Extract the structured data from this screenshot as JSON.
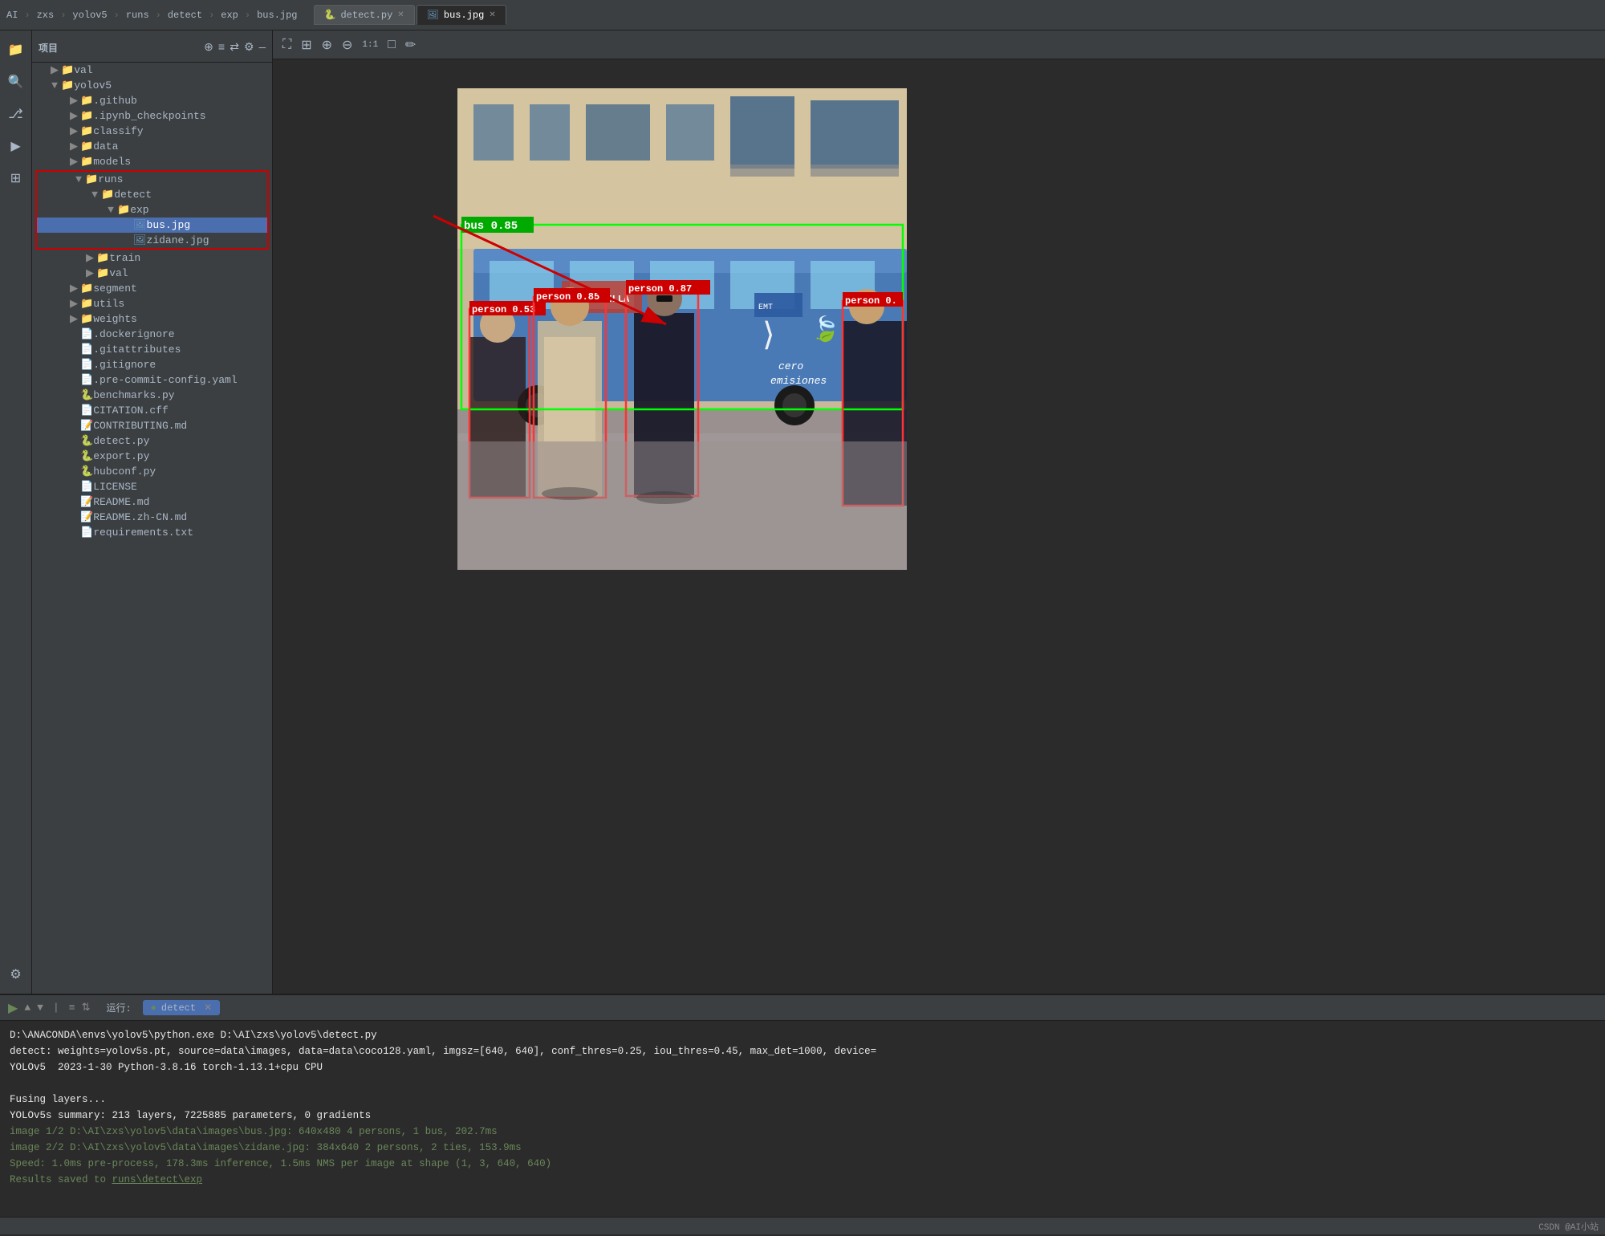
{
  "topbar": {
    "breadcrumbs": [
      "AI",
      "zxs",
      "yolov5",
      "runs",
      "detect",
      "exp",
      "bus.jpg"
    ],
    "tabs": [
      {
        "label": "detect.py",
        "active": false,
        "icon": "py"
      },
      {
        "label": "bus.jpg",
        "active": true,
        "icon": "img"
      }
    ]
  },
  "sidebar": {
    "title": "项目",
    "toolbar_icons": [
      "⊕",
      "≡",
      "⇄",
      "⚙",
      "—"
    ],
    "tree": [
      {
        "level": 1,
        "type": "folder",
        "name": "val",
        "arrow": "▶",
        "indent": 20
      },
      {
        "level": 1,
        "type": "folder",
        "name": "yolov5",
        "arrow": "▼",
        "indent": 20,
        "open": true
      },
      {
        "level": 2,
        "type": "folder",
        "name": ".github",
        "arrow": "▶",
        "indent": 40
      },
      {
        "level": 2,
        "type": "folder",
        "name": ".ipynb_checkpoints",
        "arrow": "▶",
        "indent": 40
      },
      {
        "level": 2,
        "type": "folder",
        "name": "classify",
        "arrow": "▶",
        "indent": 40
      },
      {
        "level": 2,
        "type": "folder",
        "name": "data",
        "arrow": "▶",
        "indent": 40
      },
      {
        "level": 2,
        "type": "folder",
        "name": "models",
        "arrow": "▶",
        "indent": 40
      },
      {
        "level": 2,
        "type": "folder",
        "name": "runs",
        "arrow": "▼",
        "indent": 40,
        "open": true,
        "redbox_start": true
      },
      {
        "level": 3,
        "type": "folder",
        "name": "detect",
        "arrow": "▼",
        "indent": 60,
        "open": true
      },
      {
        "level": 4,
        "type": "folder",
        "name": "exp",
        "arrow": "▼",
        "indent": 80,
        "open": true
      },
      {
        "level": 5,
        "type": "file",
        "name": "bus.jpg",
        "icon": "img",
        "indent": 100,
        "selected": true
      },
      {
        "level": 5,
        "type": "file",
        "name": "zidane.jpg",
        "icon": "img",
        "indent": 100,
        "redbox_end": true
      },
      {
        "level": 3,
        "type": "folder",
        "name": "train",
        "arrow": "▶",
        "indent": 60
      },
      {
        "level": 3,
        "type": "folder",
        "name": "val",
        "arrow": "▶",
        "indent": 60
      },
      {
        "level": 2,
        "type": "folder",
        "name": "segment",
        "arrow": "▶",
        "indent": 40
      },
      {
        "level": 2,
        "type": "folder",
        "name": "utils",
        "arrow": "▶",
        "indent": 40
      },
      {
        "level": 2,
        "type": "folder",
        "name": "weights",
        "arrow": "▶",
        "indent": 40
      },
      {
        "level": 2,
        "type": "file",
        "name": ".dockerignore",
        "icon": "git",
        "indent": 40
      },
      {
        "level": 2,
        "type": "file",
        "name": ".gitattributes",
        "icon": "git",
        "indent": 40
      },
      {
        "level": 2,
        "type": "file",
        "name": ".gitignore",
        "icon": "git",
        "indent": 40
      },
      {
        "level": 2,
        "type": "file",
        "name": ".pre-commit-config.yaml",
        "icon": "yaml",
        "indent": 40
      },
      {
        "level": 2,
        "type": "file",
        "name": "benchmarks.py",
        "icon": "py",
        "indent": 40
      },
      {
        "level": 2,
        "type": "file",
        "name": "CITATION.cff",
        "icon": "file",
        "indent": 40
      },
      {
        "level": 2,
        "type": "file",
        "name": "CONTRIBUTING.md",
        "icon": "md",
        "indent": 40
      },
      {
        "level": 2,
        "type": "file",
        "name": "detect.py",
        "icon": "py",
        "indent": 40
      },
      {
        "level": 2,
        "type": "file",
        "name": "export.py",
        "icon": "py",
        "indent": 40
      },
      {
        "level": 2,
        "type": "file",
        "name": "hubconf.py",
        "icon": "py",
        "indent": 40
      },
      {
        "level": 2,
        "type": "file",
        "name": "LICENSE",
        "icon": "file",
        "indent": 40
      },
      {
        "level": 2,
        "type": "file",
        "name": "README.md",
        "icon": "md",
        "indent": 40
      },
      {
        "level": 2,
        "type": "file",
        "name": "README.zh-CN.md",
        "icon": "md",
        "indent": 40
      },
      {
        "level": 2,
        "type": "file",
        "name": "requirements.txt",
        "icon": "txt",
        "indent": 40
      }
    ]
  },
  "editor": {
    "toolbar_icons": [
      "⛶",
      "⊞",
      "⊕",
      "⊖",
      "1:1",
      "□",
      "✏"
    ]
  },
  "terminal": {
    "run_label": "运行:",
    "tab_label": "detect",
    "lines": [
      {
        "text": "D:\\ANACONDA\\envs\\yolov5\\python.exe D:\\AI\\zxs\\yolov5\\detect.py",
        "color": "white"
      },
      {
        "text": "detect: weights=yolov5s.pt, source=data\\images, data=data\\coco128.yaml, imgsz=[640, 640], conf_thres=0.25, iou_thres=0.45, max_det=1000, device=",
        "color": "white"
      },
      {
        "text": "YOLOv5  2023-1-30 Python-3.8.16 torch-1.13.1+cpu CPU",
        "color": "white"
      },
      {
        "text": "",
        "color": "white"
      },
      {
        "text": "Fusing layers...",
        "color": "white"
      },
      {
        "text": "YOLOv5s summary: 213 layers, 7225885 parameters, 0 gradients",
        "color": "white"
      },
      {
        "text": "image 1/2 D:\\AI\\zxs\\yolov5\\data\\images\\bus.jpg: 640x480 4 persons, 1 bus, 202.7ms",
        "color": "green"
      },
      {
        "text": "image 2/2 D:\\AI\\zxs\\yolov5\\data\\images\\zidane.jpg: 384x640 2 persons, 2 ties, 153.9ms",
        "color": "green"
      },
      {
        "text": "Speed: 1.0ms pre-process, 178.3ms inference, 1.5ms NMS per image at shape (1, 3, 640, 640)",
        "color": "green"
      },
      {
        "text": "Results saved to runs\\detect\\exp",
        "color": "green"
      }
    ]
  },
  "detection_labels": {
    "bus": "bus 0.85",
    "person1": "person 0.85",
    "person2": "person 0.87",
    "person3": "person 0.53",
    "person4": "person 0."
  },
  "statusbar": {
    "right_text": "CSDN @AI小站"
  }
}
